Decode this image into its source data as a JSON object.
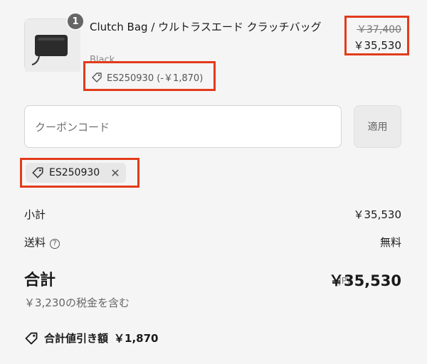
{
  "product": {
    "quantity": "1",
    "title": "Clutch Bag / ウルトラスエード クラッチバッグ",
    "variant": "Black",
    "price_original": "￥37,400",
    "price_final": "￥35,530",
    "discount_line": "ES250930 (-￥1,870)"
  },
  "coupon": {
    "placeholder": "クーポンコード",
    "apply_label": "適用",
    "applied_code": "ES250930",
    "remove_symbol": "✕"
  },
  "summary": {
    "subtotal_label": "小計",
    "subtotal_value": "￥35,530",
    "shipping_label": "送料",
    "shipping_help": "?",
    "shipping_value": "無料",
    "total_label": "合計",
    "currency": "JPY",
    "total_value": "￥35,530",
    "tax_note": "￥3,230の税金を含む",
    "savings_label": "合計値引き額",
    "savings_value": "￥1,870"
  },
  "colors": {
    "highlight": "#e23b1c",
    "background": "#f5f5f5"
  },
  "icons": [
    "tag-icon",
    "help-circle-icon",
    "close-icon"
  ]
}
